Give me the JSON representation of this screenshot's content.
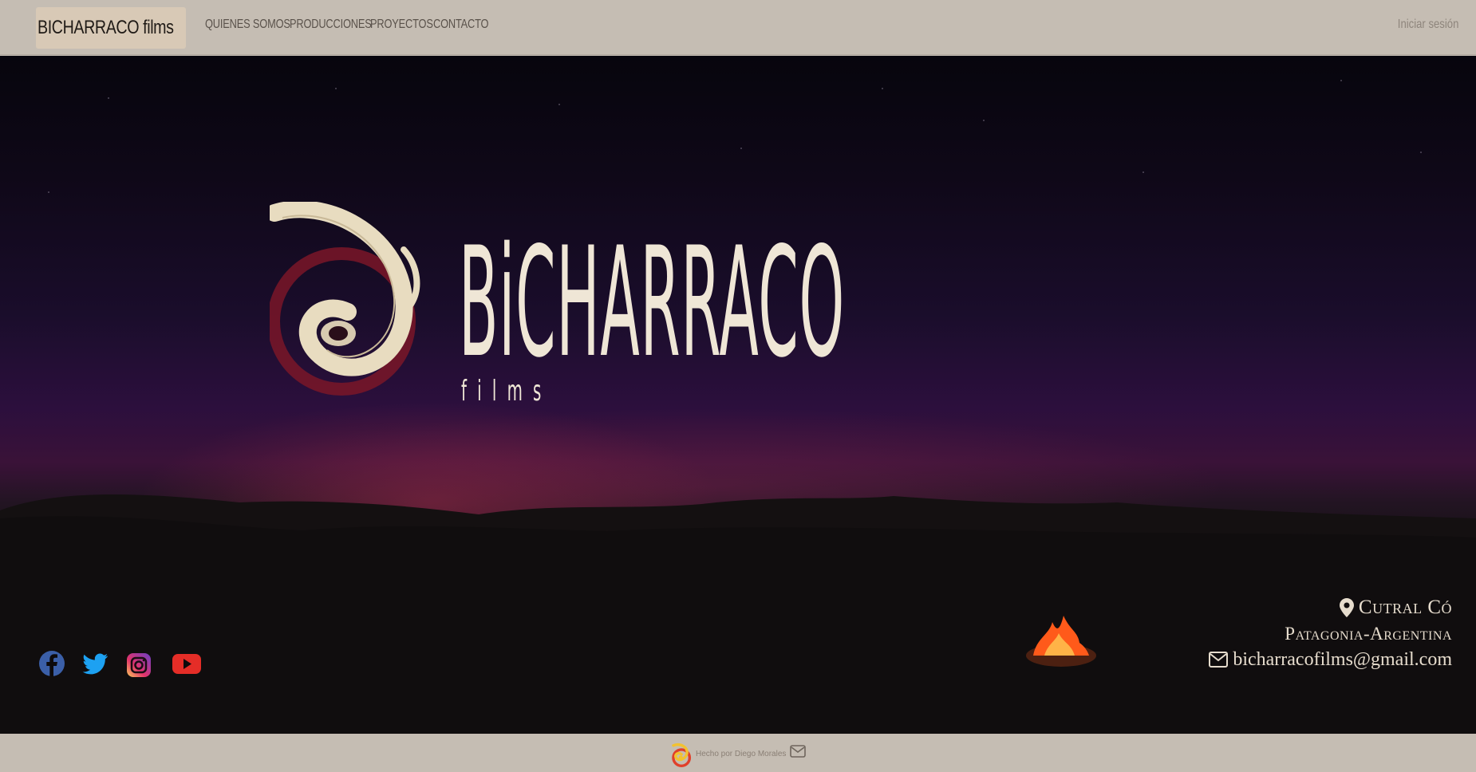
{
  "navbar": {
    "brand": "BICHARRACO films",
    "links": [
      "QUIENES SOMOS",
      "PRODUCCIONES",
      "PROYECTOS",
      "CONTACTO"
    ],
    "login": "Iniciar sesión"
  },
  "hero": {
    "title": "BiCHARRACO",
    "subtitle": "films"
  },
  "socials": [
    "facebook-icon",
    "twitter-icon",
    "instagram-icon",
    "youtube-icon"
  ],
  "contact": {
    "city": "Cutral Có",
    "region": "Patagonia-Argentina",
    "email": "bicharracofilms@gmail.com"
  },
  "footer": {
    "credit": "Hecho por Diego Morales"
  },
  "colors": {
    "nav_bg": "#c5bdb3",
    "brand_bg": "#d8c9b6",
    "logo_cream": "#efe6d6",
    "facebook": "#3b5fa8",
    "twitter": "#1da1f2",
    "youtube": "#e52d27"
  }
}
